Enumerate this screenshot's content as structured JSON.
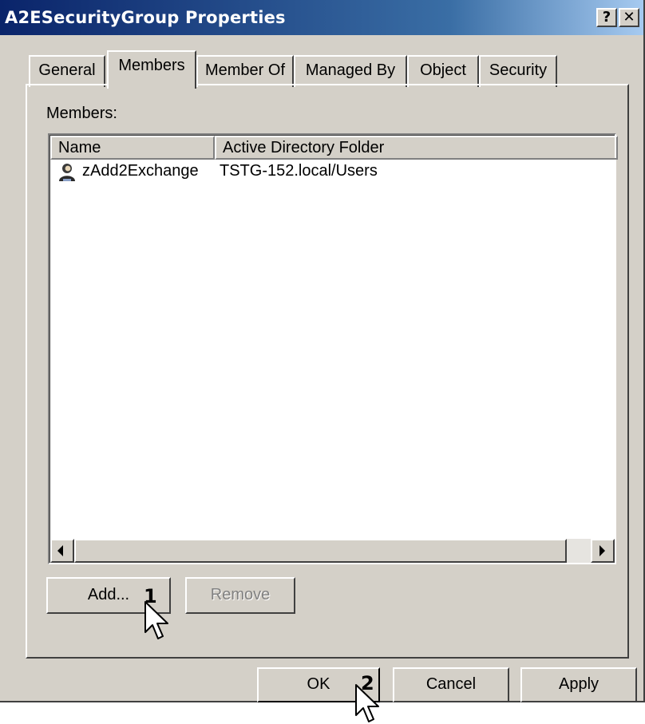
{
  "window": {
    "title": "A2ESecurityGroup Properties",
    "help_glyph": "?",
    "close_glyph": "✕"
  },
  "tabs": [
    {
      "label": "General",
      "active": false
    },
    {
      "label": "Members",
      "active": true
    },
    {
      "label": "Member Of",
      "active": false
    },
    {
      "label": "Managed By",
      "active": false
    },
    {
      "label": "Object",
      "active": false
    },
    {
      "label": "Security",
      "active": false
    }
  ],
  "members": {
    "label": "Members:",
    "columns": [
      "Name",
      "Active Directory Folder"
    ],
    "rows": [
      {
        "icon": "user-icon",
        "name": "zAdd2Exchange",
        "folder": "TSTG-152.local/Users"
      }
    ]
  },
  "buttons": {
    "add": "Add...",
    "remove": "Remove",
    "ok": "OK",
    "cancel": "Cancel",
    "apply": "Apply"
  },
  "annotations": {
    "step1": "1",
    "step2": "2"
  },
  "colors": {
    "titlebar_start": "#0a246a",
    "titlebar_end": "#a6caf0",
    "face": "#d4d0c8"
  }
}
